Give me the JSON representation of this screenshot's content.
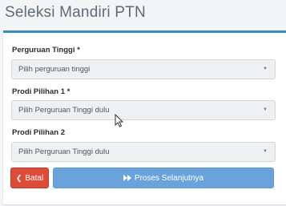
{
  "page": {
    "title": "Seleksi Mandiri PTN"
  },
  "form": {
    "university": {
      "label": "Perguruan Tinggi *",
      "value": "Pilih perguruan tinggi"
    },
    "prodi1": {
      "label": "Prodi Pilihan 1 *",
      "value": "Pilih Perguruan Tinggi dulu"
    },
    "prodi2": {
      "label": "Prodi Pilihan 2",
      "value": "Pilih Perguruan Tinggi dulu"
    }
  },
  "buttons": {
    "cancel": {
      "label": "Batal",
      "icon": "chevron-left-icon"
    },
    "next": {
      "label": "Proses Selanjutnya",
      "icon": "fast-forward-icon"
    }
  },
  "colors": {
    "accent": "#3c8dbc",
    "danger": "#dd4b39",
    "primary": "#6aa3dc"
  }
}
